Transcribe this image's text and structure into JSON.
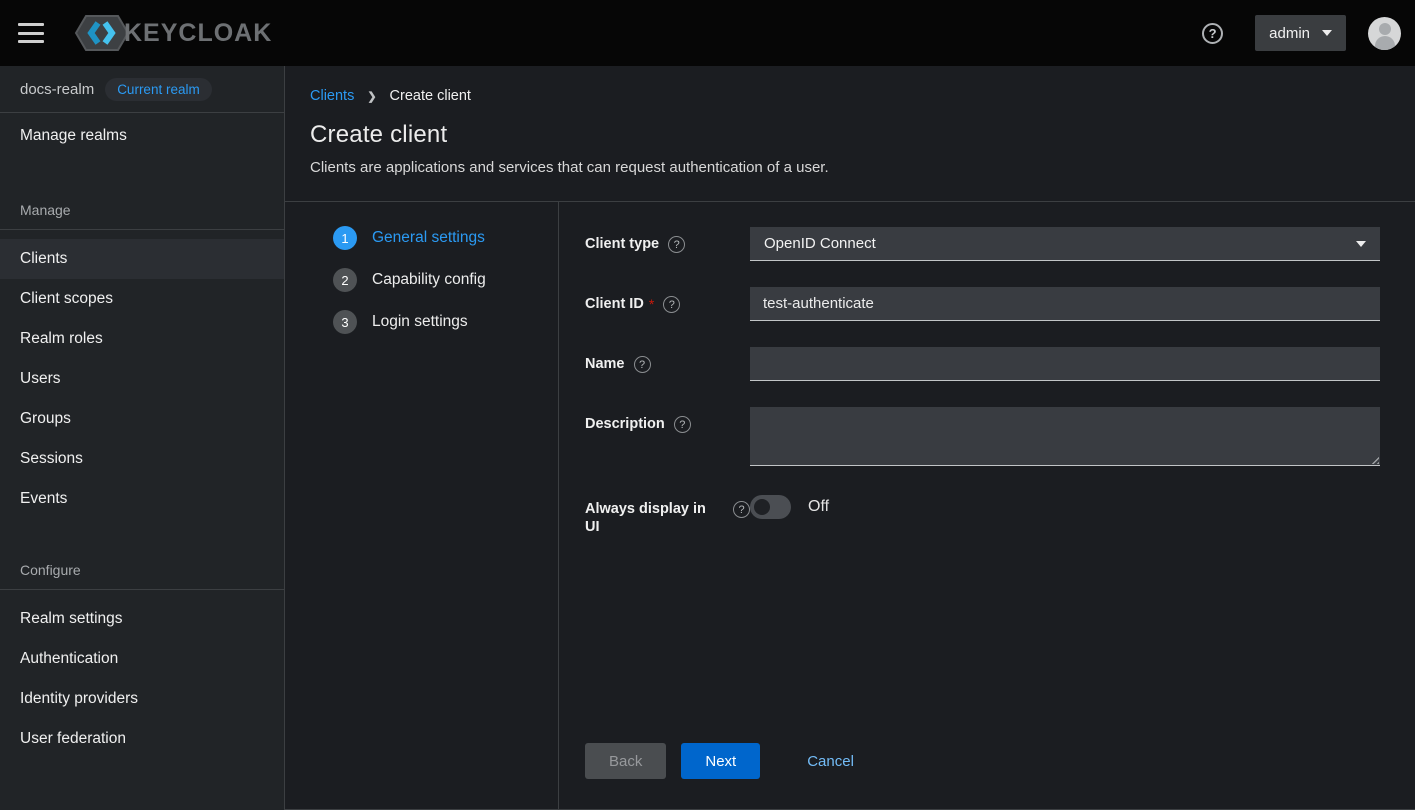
{
  "colors": {
    "accent_blue": "#2b9af3",
    "primary_button_blue": "#0066cc",
    "link_blue": "#73bcf7",
    "danger_red": "#c9190b"
  },
  "header": {
    "brand_text": "KEYCLOAK",
    "user_menu_label": "admin"
  },
  "sidebar": {
    "realm_name": "docs-realm",
    "realm_badge": "Current realm",
    "manage_realms_label": "Manage realms",
    "manage_group_label": "Manage",
    "manage_items": [
      "Clients",
      "Client scopes",
      "Realm roles",
      "Users",
      "Groups",
      "Sessions",
      "Events"
    ],
    "configure_group_label": "Configure",
    "configure_items": [
      "Realm settings",
      "Authentication",
      "Identity providers",
      "User federation"
    ]
  },
  "breadcrumb": {
    "link": "Clients",
    "current": "Create client"
  },
  "page": {
    "title": "Create client",
    "subtitle": "Clients are applications and services that can request authentication of a user."
  },
  "wizard": {
    "steps": [
      {
        "num": "1",
        "label": "General settings"
      },
      {
        "num": "2",
        "label": "Capability config"
      },
      {
        "num": "3",
        "label": "Login settings"
      }
    ]
  },
  "form": {
    "client_type": {
      "label": "Client type",
      "value": "OpenID Connect"
    },
    "client_id": {
      "label": "Client ID",
      "required_marker": "*",
      "value": "test-authenticate"
    },
    "name": {
      "label": "Name",
      "value": ""
    },
    "description": {
      "label": "Description",
      "value": ""
    },
    "always_display": {
      "label": "Always display in UI",
      "state_label": "Off"
    }
  },
  "footer": {
    "back_label": "Back",
    "next_label": "Next",
    "cancel_label": "Cancel"
  }
}
